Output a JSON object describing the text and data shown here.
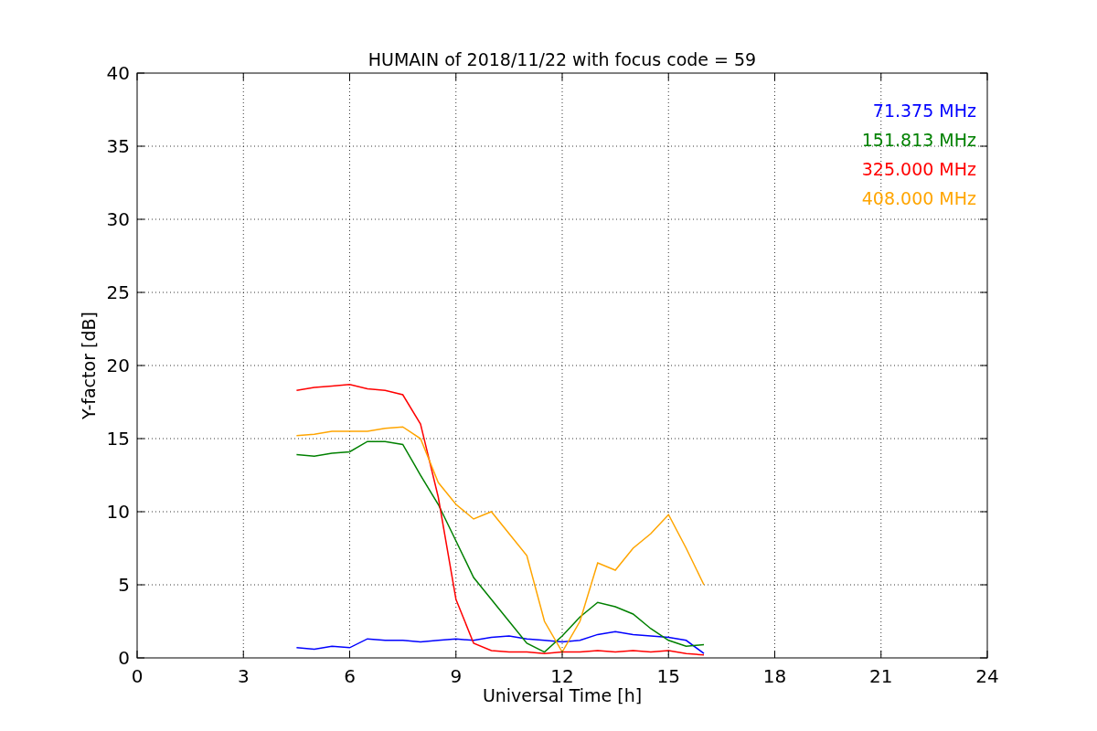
{
  "figure": {
    "chart_data": {
      "type": "line",
      "title": "HUMAIN of 2018/11/22 with focus code = 59",
      "xlabel": "Universal Time [h]",
      "ylabel": "Y-factor [dB]",
      "x": [
        4.5,
        5,
        5.5,
        6,
        6.5,
        7,
        7.5,
        8,
        8.5,
        9,
        9.5,
        10,
        10.5,
        11,
        11.5,
        12,
        12.5,
        13,
        13.5,
        14,
        14.5,
        15,
        15.5,
        16
      ],
      "series": [
        {
          "name": "71.375 MHz",
          "color": "#0000ff",
          "values": [
            0.7,
            0.6,
            0.8,
            0.7,
            1.3,
            1.2,
            1.2,
            1.1,
            1.2,
            1.3,
            1.2,
            1.4,
            1.5,
            1.3,
            1.2,
            1.1,
            1.2,
            1.6,
            1.8,
            1.6,
            1.5,
            1.4,
            1.2,
            0.3
          ]
        },
        {
          "name": "151.813 MHz",
          "color": "#008000",
          "values": [
            13.9,
            13.8,
            14,
            14.1,
            14.8,
            14.8,
            14.6,
            12.5,
            10.5,
            8,
            5.5,
            4,
            2.5,
            1,
            0.4,
            1.5,
            2.8,
            3.8,
            3.5,
            3,
            2,
            1.2,
            0.8,
            0.9
          ]
        },
        {
          "name": "325.000 MHz",
          "color": "#ff0000",
          "values": [
            18.3,
            18.5,
            18.6,
            18.7,
            18.4,
            18.3,
            18,
            16,
            11,
            4,
            1,
            0.5,
            0.4,
            0.4,
            0.3,
            0.4,
            0.4,
            0.5,
            0.4,
            0.5,
            0.4,
            0.5,
            0.3,
            0.2
          ]
        },
        {
          "name": "408.000 MHz",
          "color": "#ffa500",
          "values": [
            15.2,
            15.3,
            15.5,
            15.5,
            15.5,
            15.7,
            15.8,
            15,
            12,
            10.5,
            9.5,
            10,
            8.5,
            7,
            2.5,
            0.4,
            2.5,
            6.5,
            6,
            7.5,
            8.5,
            9.8,
            7.5,
            5
          ]
        }
      ],
      "grid": true,
      "xlim": [
        0,
        24
      ],
      "ylim": [
        0,
        40
      ],
      "xticks": [
        0,
        3,
        6,
        9,
        12,
        15,
        18,
        21,
        24
      ],
      "yticks": [
        0,
        5,
        10,
        15,
        20,
        25,
        30,
        35,
        40
      ]
    }
  }
}
